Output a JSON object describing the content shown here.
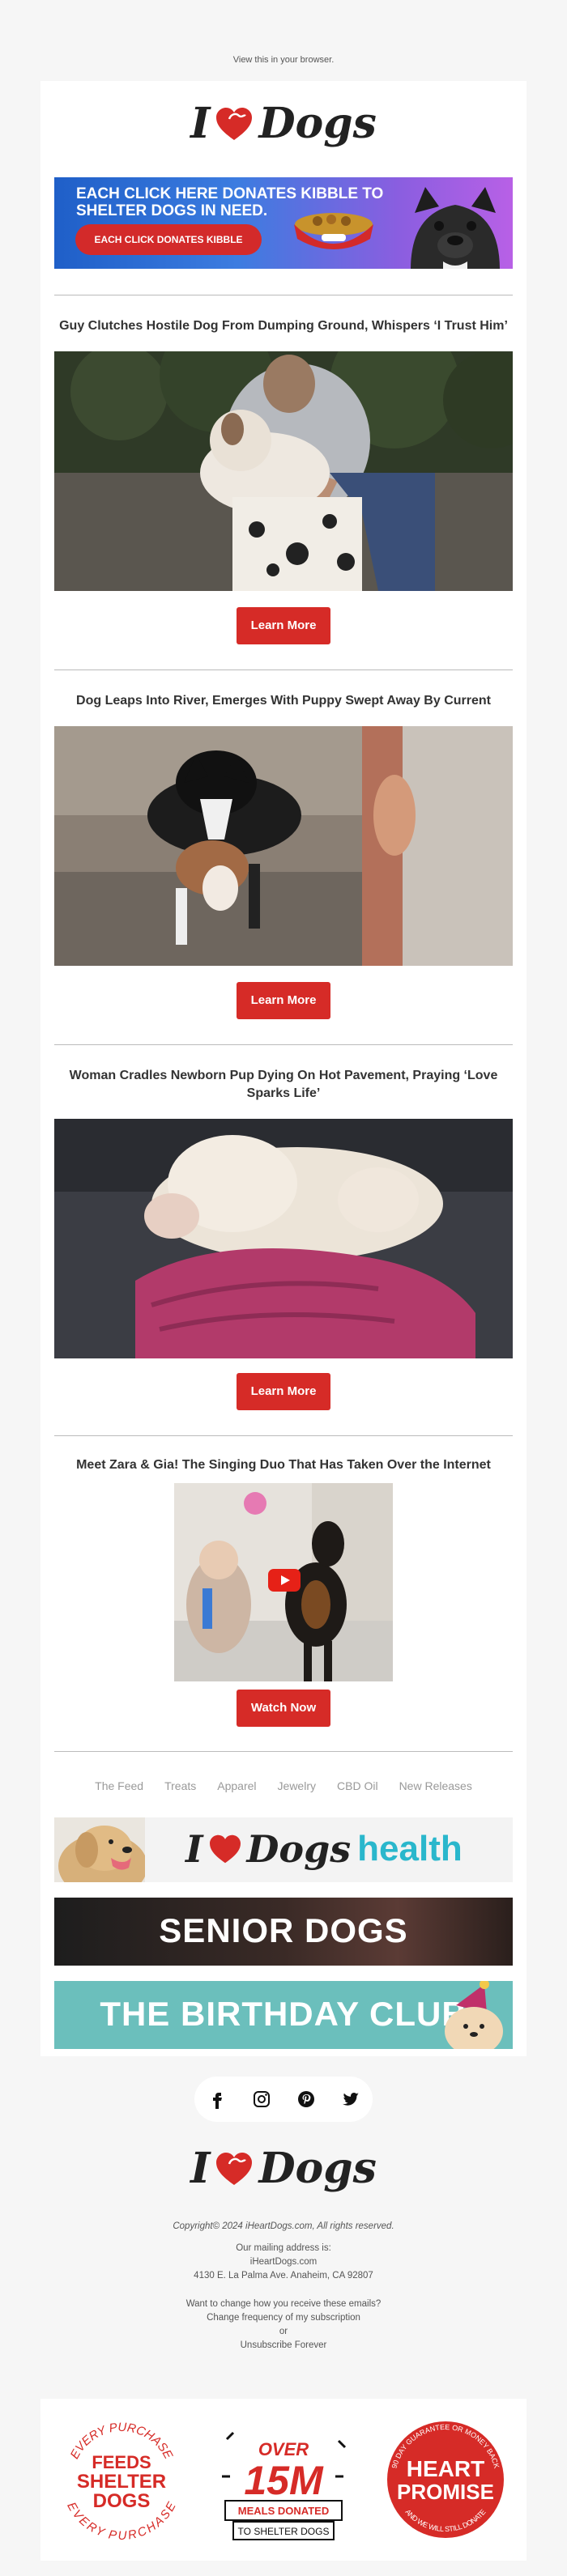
{
  "header": {
    "browser_link": "View this in your browser."
  },
  "brand": {
    "logo_text_left": "I",
    "logo_text_right": "Dogs"
  },
  "kibble_banner": {
    "headline": "EACH CLICK HERE DONATES KIBBLE TO SHELTER DOGS IN NEED.",
    "button": "EACH CLICK DONATES KIBBLE"
  },
  "articles": [
    {
      "headline": "Guy Clutches Hostile Dog From Dumping Ground, Whispers ‘I Trust Him’",
      "button": "Learn More"
    },
    {
      "headline": "Dog Leaps Into River, Emerges With Puppy Swept Away By Current",
      "button": "Learn More"
    },
    {
      "headline": "Woman Cradles Newborn Pup Dying On Hot Pavement, Praying ‘Love Sparks Life’",
      "button": "Learn More"
    },
    {
      "headline": "Meet Zara & Gia! The Singing Duo That Has Taken Over the Internet",
      "button": "Watch Now"
    }
  ],
  "nav": [
    "The Feed",
    "Treats",
    "Apparel",
    "Jewelry",
    "CBD Oil",
    "New Releases"
  ],
  "promos": {
    "health_logo_left": "I",
    "health_logo_dogs": "Dogs",
    "health_logo_word": "health",
    "senior": "SENIOR DOGS",
    "birthday": "THE BIRTHDAY CLUB"
  },
  "social": [
    "facebook-icon",
    "instagram-icon",
    "pinterest-icon",
    "twitter-icon"
  ],
  "footer": {
    "copyright": "Copyright© 2024 iHeartDogs.com, All rights reserved.",
    "mailing_label": "Our mailing address is:",
    "site": "iHeartDogs.com",
    "address": "4130 E. La Palma Ave. Anaheim, CA 92807",
    "change_q": "Want to change how you receive these emails?",
    "frequency": "Change frequency of my subscription",
    "or": "or",
    "unsubscribe": "Unsubscribe Forever"
  },
  "badges": {
    "feeds": {
      "arc_top": "EVERY PURCHASE",
      "l1": "FEEDS",
      "l2": "SHELTER",
      "l3": "DOGS",
      "arc_bottom": "EVERY PURCHASE"
    },
    "meals": {
      "l1": "OVER",
      "l2": "15M",
      "l3": "MEALS DONATED",
      "l4": "TO SHELTER DOGS"
    },
    "promise": {
      "arc_top": "90 DAY GUARANTEE OR MONEY BACK",
      "l1": "HEART",
      "l2": "PROMISE",
      "arc_bottom": "AND WE WILL STILL DONATE"
    }
  },
  "colors": {
    "accent": "#d62b27",
    "health_teal": "#2ab7cc",
    "birthday_bg": "#6bbfbc"
  }
}
